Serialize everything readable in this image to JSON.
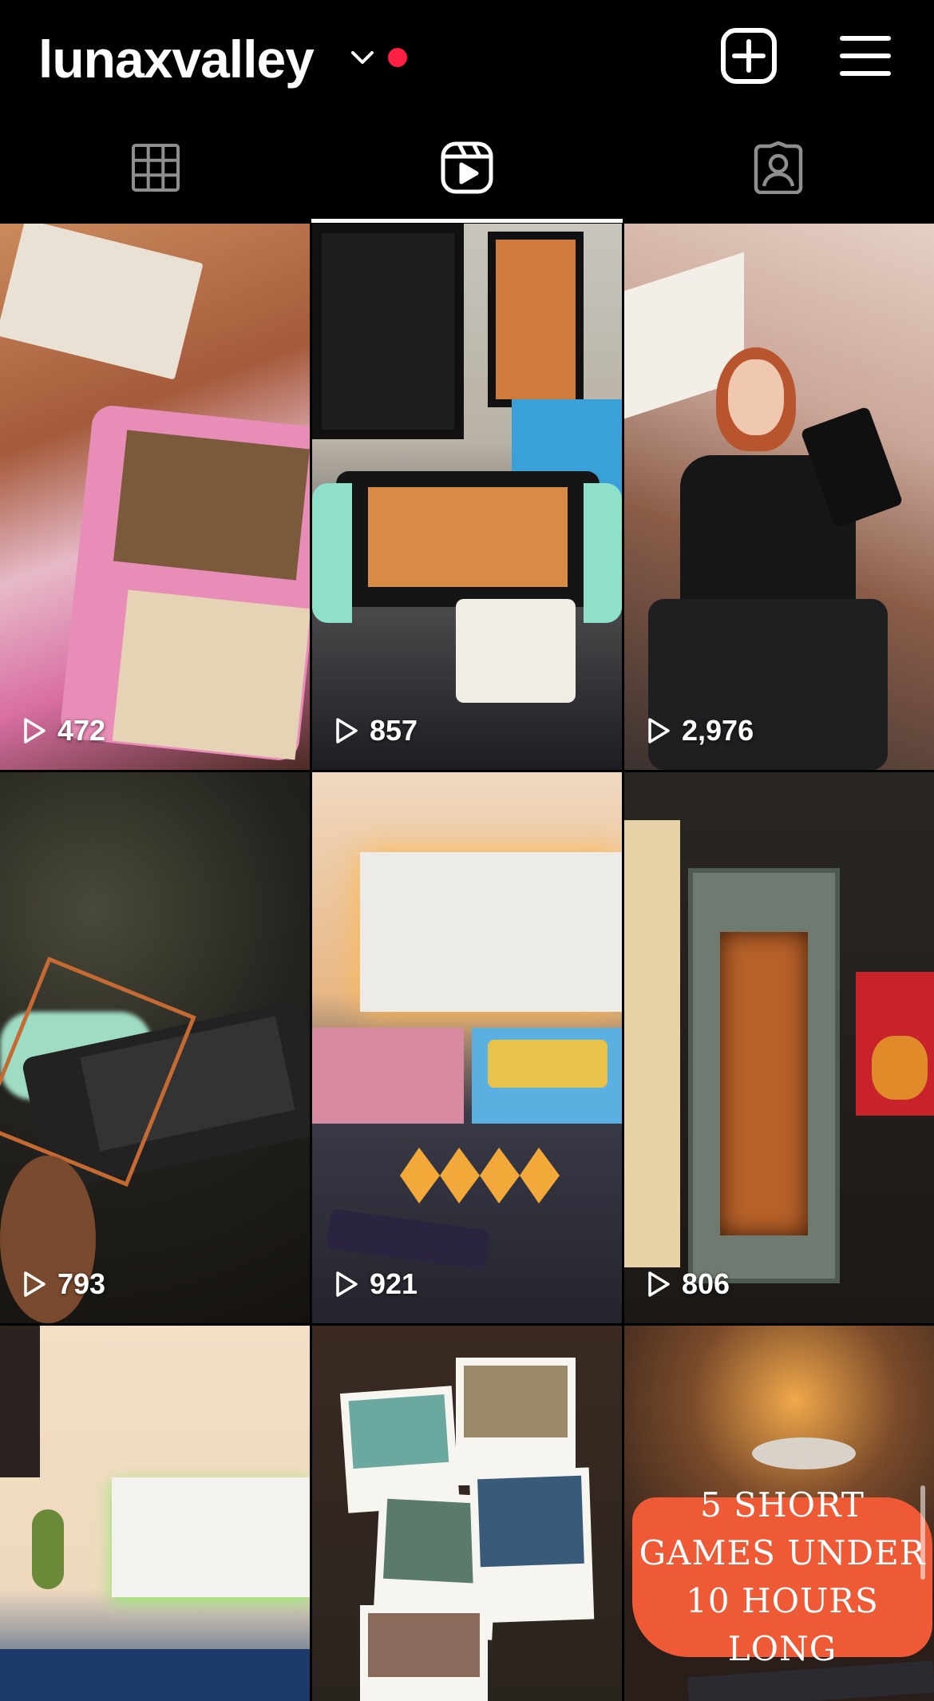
{
  "header": {
    "username": "lunaxvalley",
    "icons": {
      "switch": "chevron-down-icon",
      "create": "plus-square-icon",
      "menu": "hamburger-menu-icon"
    },
    "notification_color": "#ff2044"
  },
  "tabs": [
    {
      "name": "posts",
      "icon": "grid-icon",
      "selected": false
    },
    {
      "name": "reels",
      "icon": "reels-icon",
      "selected": true
    },
    {
      "name": "tagged",
      "icon": "tagged-person-icon",
      "selected": false
    }
  ],
  "reels": [
    {
      "views": "472"
    },
    {
      "views": "857"
    },
    {
      "views": "2,976"
    },
    {
      "views": "793"
    },
    {
      "views": "921"
    },
    {
      "views": "806"
    },
    {
      "views": ""
    },
    {
      "views": ""
    },
    {
      "views": "",
      "overlay_text": "5 SHORT GAMES UNDER 10 HOURS LONG"
    }
  ]
}
